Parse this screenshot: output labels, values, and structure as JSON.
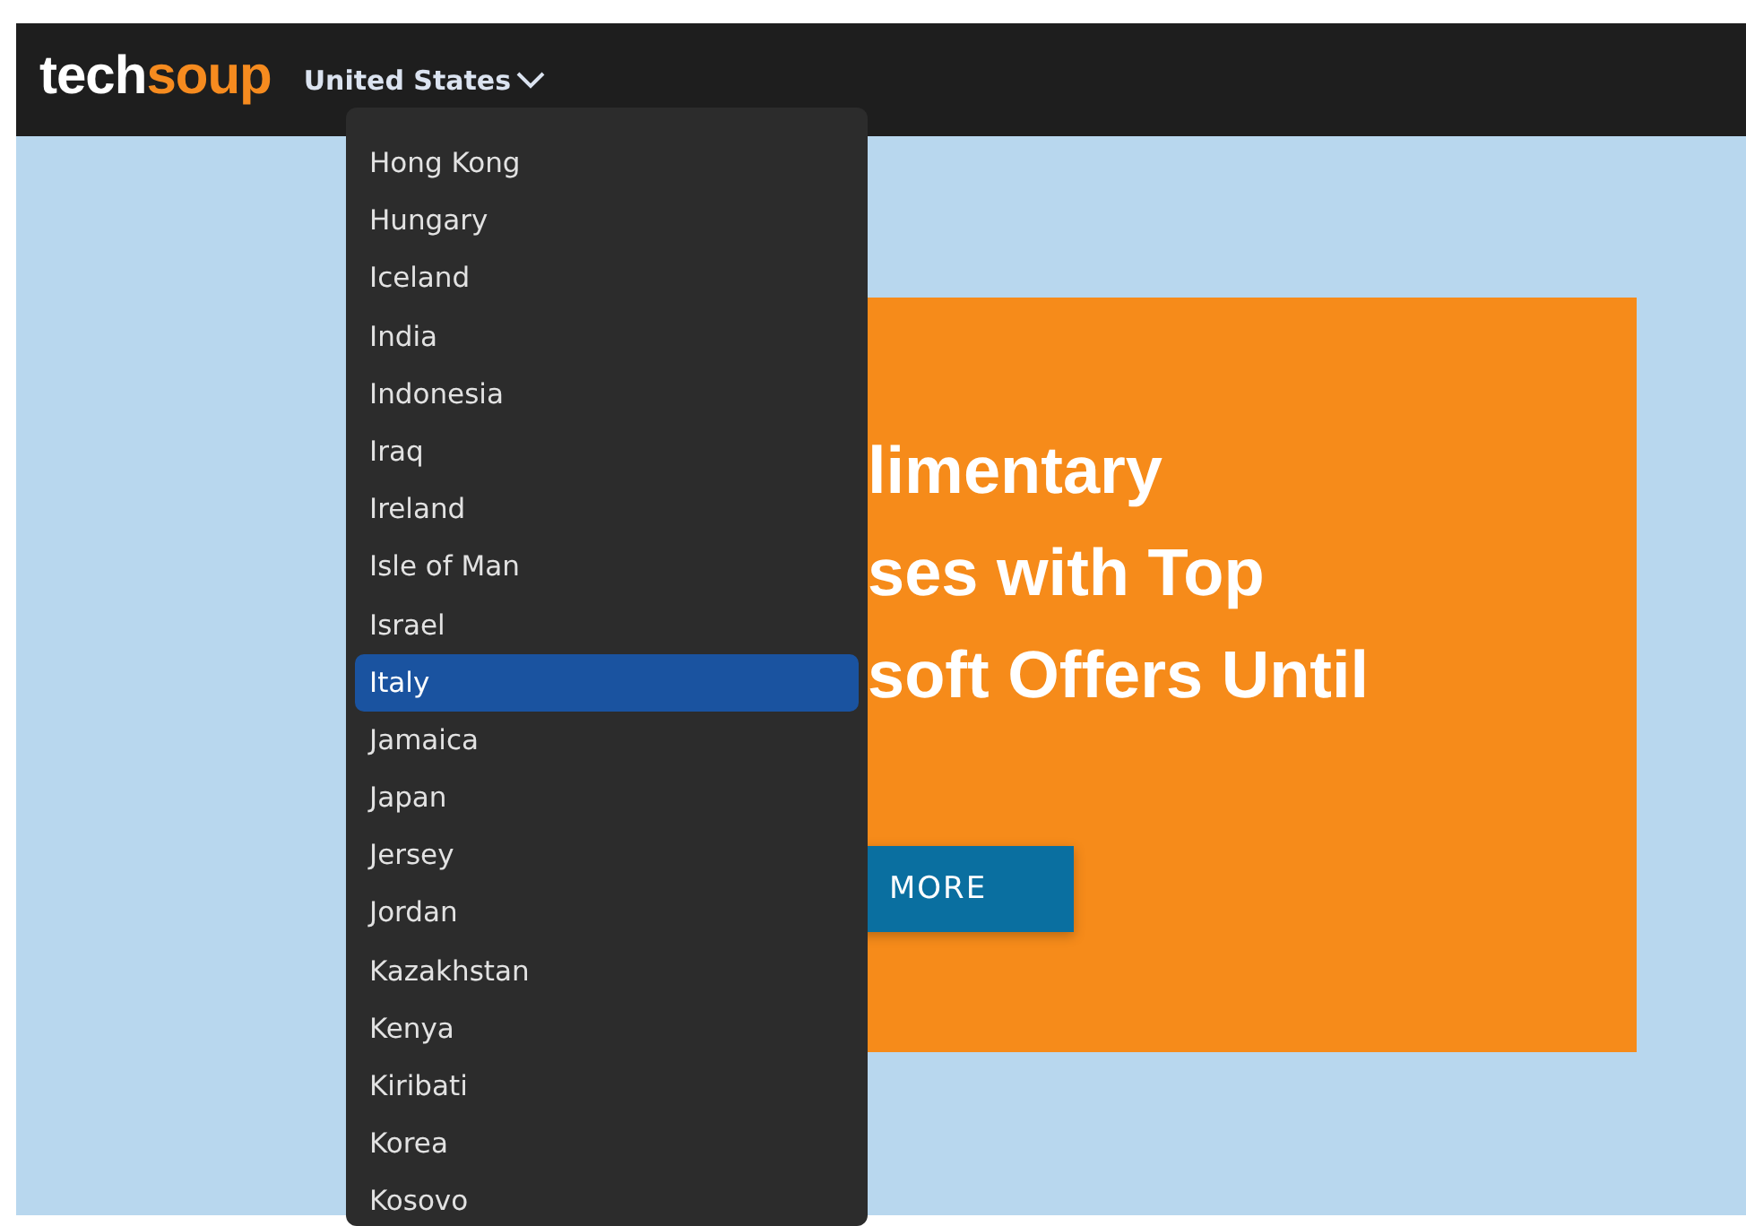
{
  "header": {
    "logo": {
      "part_1": "tech",
      "part_2": "soup"
    },
    "country_selector": {
      "label": "United States",
      "expanded": true
    }
  },
  "country_list": [
    {
      "label": "Hong Kong",
      "selected": false
    },
    {
      "label": "Hungary",
      "selected": false
    },
    {
      "label": "Iceland",
      "selected": false
    },
    {
      "label": "India",
      "selected": false
    },
    {
      "label": "Indonesia",
      "selected": false
    },
    {
      "label": "Iraq",
      "selected": false
    },
    {
      "label": "Ireland",
      "selected": false
    },
    {
      "label": "Isle of Man",
      "selected": false
    },
    {
      "label": "Israel",
      "selected": false
    },
    {
      "label": "Italy",
      "selected": true
    },
    {
      "label": "Jamaica",
      "selected": false
    },
    {
      "label": "Japan",
      "selected": false
    },
    {
      "label": "Jersey",
      "selected": false
    },
    {
      "label": "Jordan",
      "selected": false
    },
    {
      "label": "Kazakhstan",
      "selected": false
    },
    {
      "label": "Kenya",
      "selected": false
    },
    {
      "label": "Kiribati",
      "selected": false
    },
    {
      "label": "Korea",
      "selected": false
    },
    {
      "label": "Kosovo",
      "selected": false
    }
  ],
  "promo": {
    "heading_lines": [
      "limentary",
      "ses with Top",
      "soft Offers Until"
    ],
    "button": "MORE"
  }
}
